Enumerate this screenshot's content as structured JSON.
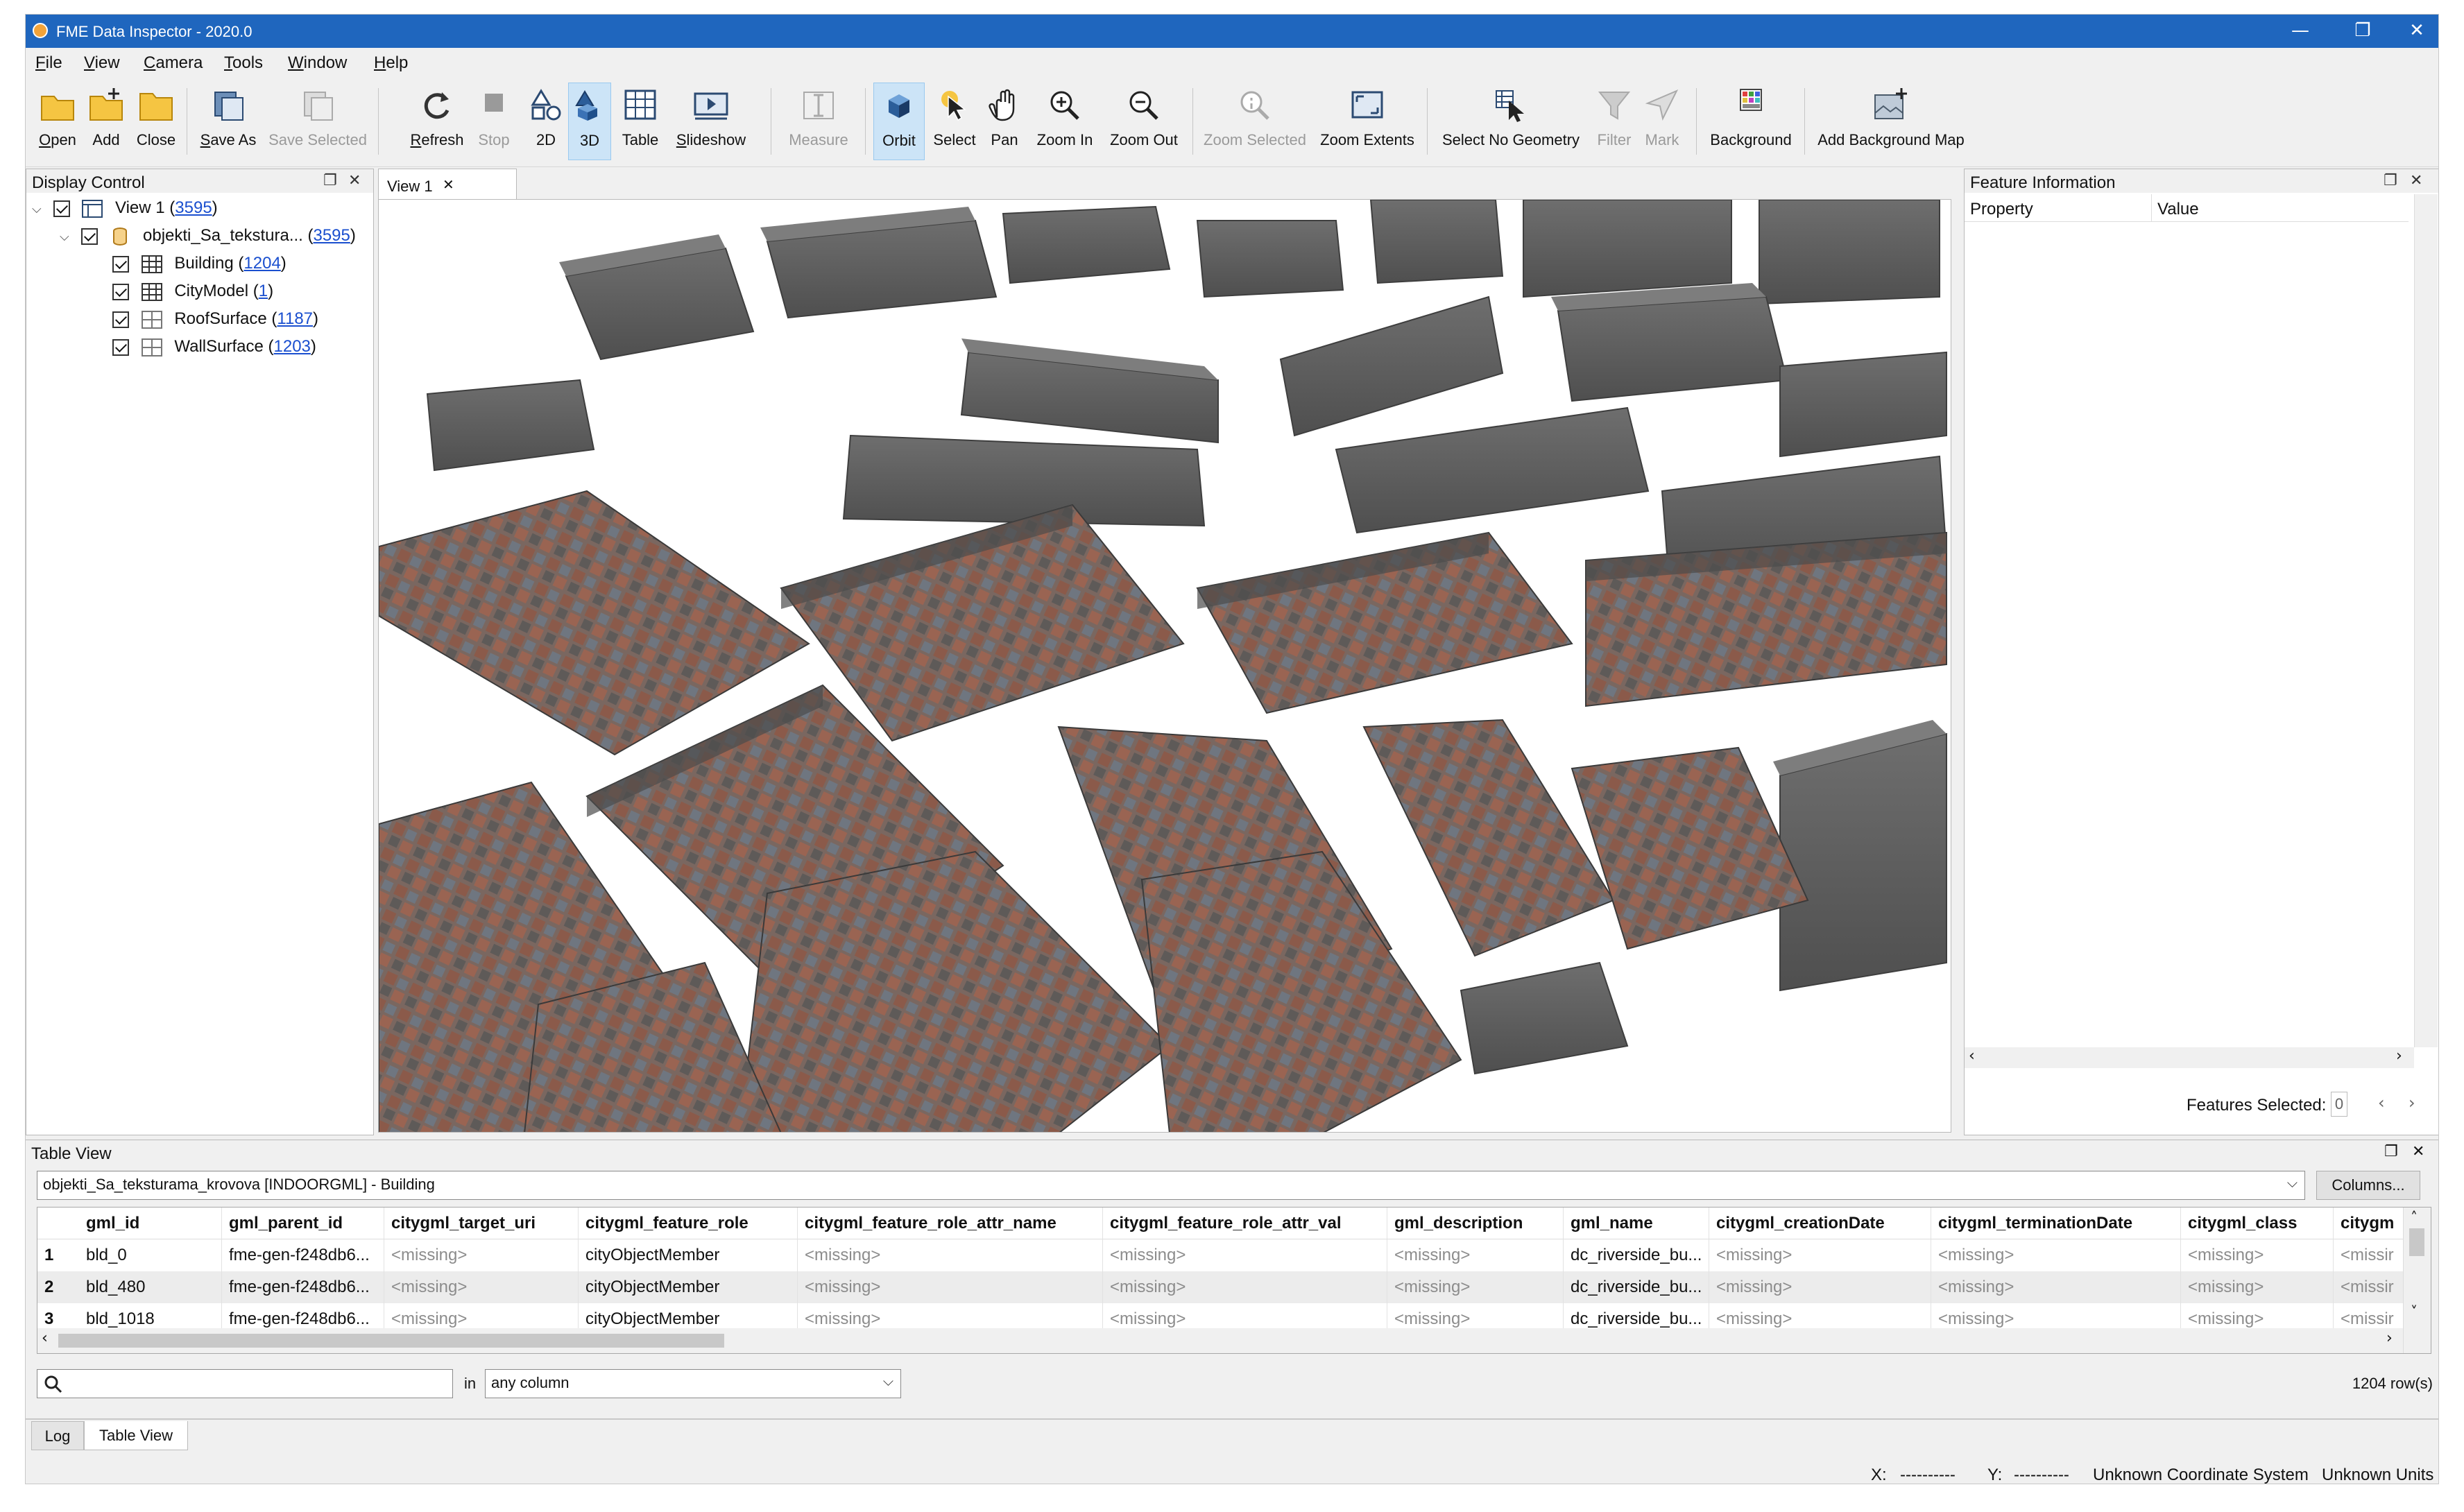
{
  "window": {
    "title": "FME Data Inspector - 2020.0",
    "controls": {
      "minimize": "—",
      "restore": "❐",
      "close": "✕"
    }
  },
  "menu": [
    "File",
    "View",
    "Camera",
    "Tools",
    "Window",
    "Help"
  ],
  "toolbar": {
    "open": "Open",
    "add": "Add",
    "close": "Close",
    "save_as": "Save As",
    "save_selected": "Save Selected",
    "refresh": "Refresh",
    "stop": "Stop",
    "view_2d": "2D",
    "view_3d": "3D",
    "table": "Table",
    "slideshow": "Slideshow",
    "measure": "Measure",
    "orbit": "Orbit",
    "select": "Select",
    "pan": "Pan",
    "zoom_in": "Zoom In",
    "zoom_out": "Zoom Out",
    "zoom_selected": "Zoom Selected",
    "zoom_extents": "Zoom Extents",
    "select_no_geometry": "Select No Geometry",
    "filter": "Filter",
    "mark": "Mark",
    "background": "Background",
    "add_background_map": "Add Background Map"
  },
  "display_control": {
    "title": "Display Control",
    "tree": [
      {
        "label": "View 1 (",
        "count": "3595",
        "close": ")"
      },
      {
        "label": "objekti_Sa_tekstura... (",
        "count": "3595",
        "close": ")"
      },
      {
        "label": "Building (",
        "count": "1204",
        "close": ")"
      },
      {
        "label": "CityModel (",
        "count": "1",
        "close": ")"
      },
      {
        "label": "RoofSurface (",
        "count": "1187",
        "close": ")"
      },
      {
        "label": "WallSurface (",
        "count": "1203",
        "close": ")"
      }
    ]
  },
  "view_tab": {
    "label": "View 1",
    "close": "✕"
  },
  "feature_info": {
    "title": "Feature Information",
    "col_property": "Property",
    "col_value": "Value",
    "features_selected_label": "Features Selected:",
    "features_selected_value": "0"
  },
  "table_view": {
    "title": "Table View",
    "dataset": "objekti_Sa_teksturama_krovova [INDOORGML] - Building",
    "columns_button": "Columns...",
    "headers": [
      "gml_id",
      "gml_parent_id",
      "citygml_target_uri",
      "citygml_feature_role",
      "citygml_feature_role_attr_name",
      "citygml_feature_role_attr_val",
      "gml_description",
      "gml_name",
      "citygml_creationDate",
      "citygml_terminationDate",
      "citygml_class",
      "citygm"
    ],
    "rows": [
      {
        "num": "1",
        "cells": [
          "bld_0",
          "fme-gen-f248db6...",
          "<missing>",
          "cityObjectMember",
          "<missing>",
          "<missing>",
          "<missing>",
          "dc_riverside_bu...",
          "<missing>",
          "<missing>",
          "<missing>",
          "<missir"
        ]
      },
      {
        "num": "2",
        "cells": [
          "bld_480",
          "fme-gen-f248db6...",
          "<missing>",
          "cityObjectMember",
          "<missing>",
          "<missing>",
          "<missing>",
          "dc_riverside_bu...",
          "<missing>",
          "<missing>",
          "<missing>",
          "<missir"
        ]
      },
      {
        "num": "3",
        "cells": [
          "bld_1018",
          "fme-gen-f248db6...",
          "<missing>",
          "cityObjectMember",
          "<missing>",
          "<missing>",
          "<missing>",
          "dc_riverside_bu...",
          "<missing>",
          "<missing>",
          "<missing>",
          "<missir"
        ]
      }
    ],
    "search_in_label": "in",
    "search_scope": "any column",
    "row_count": "1204 row(s)"
  },
  "bottom_tabs": [
    "Log",
    "Table View"
  ],
  "status_bar": {
    "x_label": "X:",
    "x_value": "----------",
    "y_label": "Y:",
    "y_value": "----------",
    "coord_system": "Unknown Coordinate System",
    "units": "Unknown Units"
  }
}
